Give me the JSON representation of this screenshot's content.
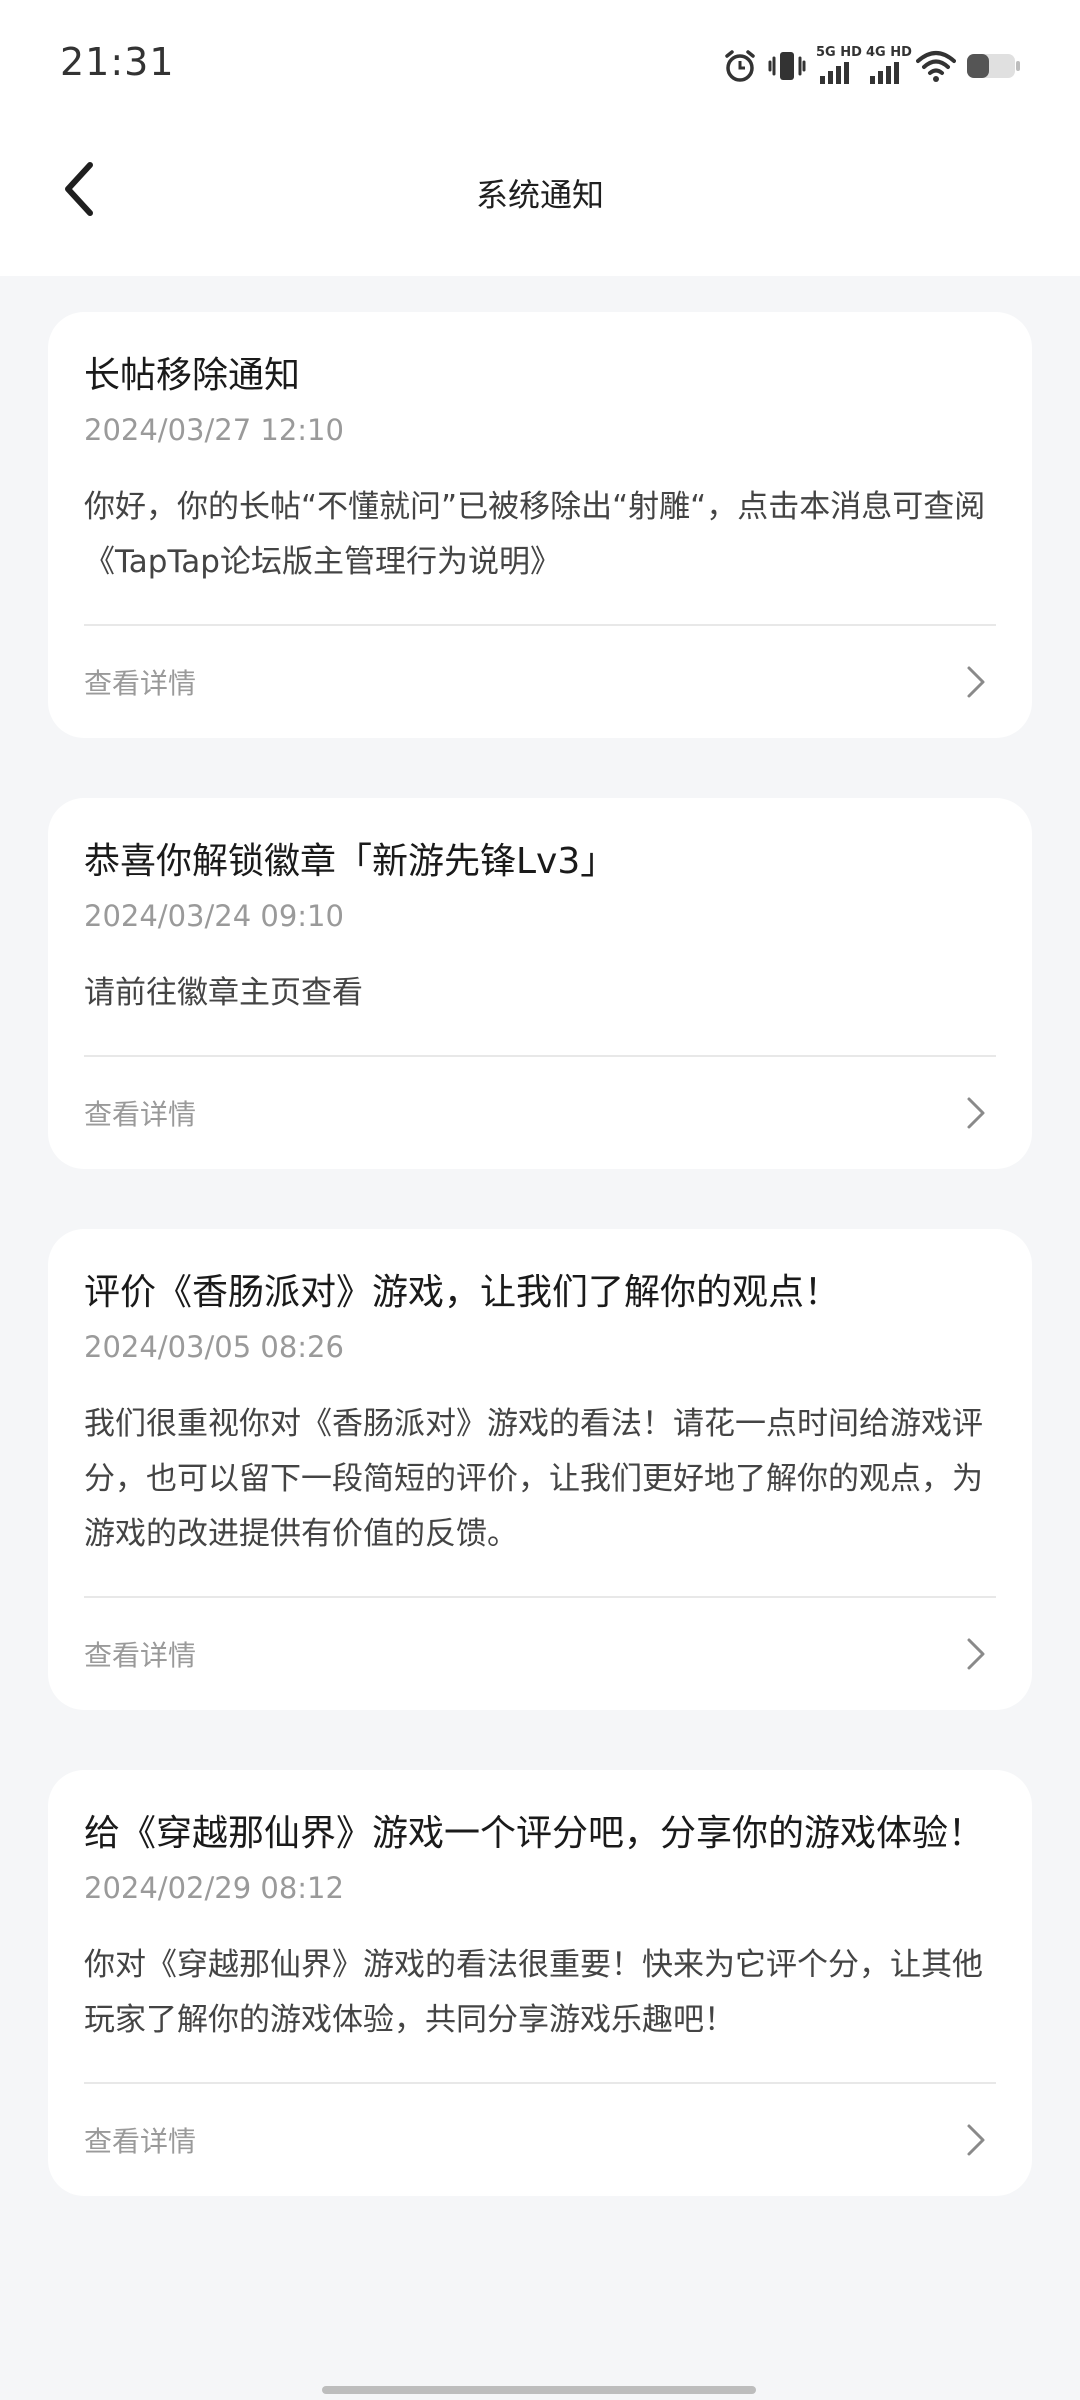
{
  "status_bar": {
    "time": "21:31",
    "icons": [
      "alarm-icon",
      "vibrate-icon",
      "signal-5g-hd-icon",
      "signal-4g-hd-icon",
      "wifi-icon",
      "battery-icon"
    ],
    "signal_labels": [
      "5G HD",
      "4G HD"
    ]
  },
  "nav": {
    "back_icon": "chevron-left-icon",
    "title": "系统通知"
  },
  "notifications": [
    {
      "title": "长帖移除通知",
      "time": "2024/03/27 12:10",
      "body": "你好，你的长帖“不懂就问”已被移除出“射雕“，点击本消息可查阅《TapTap论坛版主管理行为说明》",
      "action": "查看详情"
    },
    {
      "title": "恭喜你解锁徽章「新游先锋Lv3」",
      "time": "2024/03/24 09:10",
      "body": "请前往徽章主页查看",
      "action": "查看详情"
    },
    {
      "title": "评价《香肠派对》游戏，让我们了解你的观点！",
      "time": "2024/03/05 08:26",
      "body": "我们很重视你对《香肠派对》游戏的看法！请花一点时间给游戏评分，也可以留下一段简短的评价，让我们更好地了解你的观点，为游戏的改进提供有价值的反馈。",
      "action": "查看详情"
    },
    {
      "title": "给《穿越那仙界》游戏一个评分吧，分享你的游戏体验！",
      "time": "2024/02/29 08:12",
      "body": "你对《穿越那仙界》游戏的看法很重要！快来为它评个分，让其他玩家了解你的游戏体验，共同分享游戏乐趣吧！",
      "action": "查看详情"
    }
  ]
}
